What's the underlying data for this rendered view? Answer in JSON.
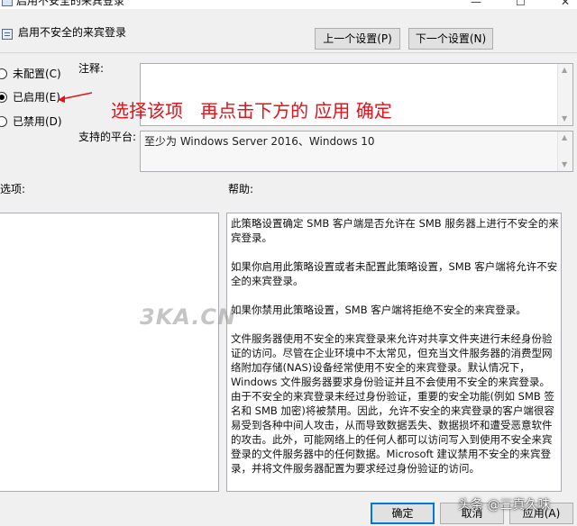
{
  "window": {
    "title": "启用不安全的来宾登录",
    "controls": {
      "minimize": "—",
      "maximize": "☐",
      "close": "✕"
    }
  },
  "header": {
    "title": "启用不安全的来宾登录",
    "prev_button": "上一个设置(P)",
    "next_button": "下一个设置(N)"
  },
  "radios": [
    {
      "label": "未配置(C)",
      "checked": false
    },
    {
      "label": "已启用(E)",
      "checked": true
    },
    {
      "label": "已禁用(D)",
      "checked": false
    }
  ],
  "comment": {
    "label": "注释:",
    "value": ""
  },
  "annotation": "选择该项   再点击下方的 应用 确定",
  "supported": {
    "label": "支持的平台:",
    "value": "至少为 Windows Server 2016、Windows 10"
  },
  "options": {
    "label": "选项:"
  },
  "help": {
    "label": "帮助:",
    "paragraphs": [
      "此策略设置确定 SMB 客户端是否允许在 SMB 服务器上进行不安全的来宾登录。",
      "如果你启用此策略设置或者未配置此策略设置，SMB 客户端将允许不安全的来宾登录。",
      "如果你禁用此策略设置，SMB 客户端将拒绝不安全的来宾登录。",
      "文件服务器使用不安全的来宾登录来允许对共享文件夹进行未经身份验证的访问。尽管在企业环境中不太常见，但充当文件服务器的消费型网络附加存储(NAS)设备经常使用不安全的来宾登录。默认情况下，Windows 文件服务器要求身份验证并且不会使用不安全的来宾登录。由于不安全的来宾登录未经过身份验证，重要的安全功能(例如 SMB 签名和 SMB 加密)将被禁用。因此，允许不安全的来宾登录的客户端很容易受到各种中间人攻击，从而导致数据丢失、数据损坏和遭受恶意软件的攻击。此外，可能网络上的任何人都可以访问写入到使用不安全来宾登录的文件服务器中的任何数据。Microsoft 建议禁用不安全的来宾登录，并将文件服务器配置为要求经过身份验证的访问。"
    ]
  },
  "footer": {
    "ok_button": "确定",
    "cancel_button": "取消",
    "apply_button": "应用(A)"
  },
  "watermark": "3KA.CN",
  "source_tag": "头条 @三真久味",
  "colors": {
    "annotation": "#e0141a",
    "window_bg": "#f0f0f0",
    "default_button_border": "#0078d7"
  }
}
